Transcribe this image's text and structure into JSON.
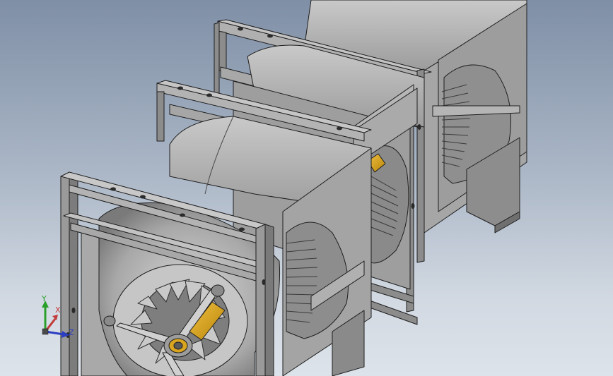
{
  "viewport": {
    "background_top": "#7f8fa6",
    "background_bottom": "#dde3ea"
  },
  "model": {
    "description_visible": false,
    "colors": {
      "housing": "#9a9a9a",
      "housing_light": "#b8b8b8",
      "housing_dark": "#6f6f6f",
      "frame": "#8c8c8c",
      "edge": "#1e1e1e",
      "shaft": "#d9a520"
    }
  },
  "triad": {
    "y_label": "Y",
    "x_label": "X",
    "z_label": "Z",
    "y_color": "#2aa02a",
    "x_color": "#c23a3a",
    "z_color": "#2b3ec2"
  }
}
